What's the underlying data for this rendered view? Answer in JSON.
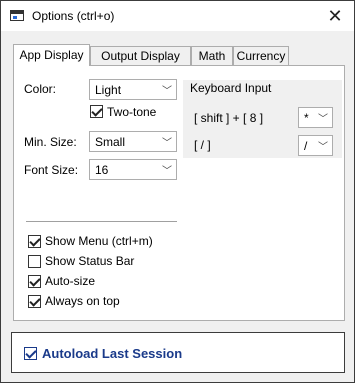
{
  "window": {
    "title": "Options (ctrl+o)",
    "close_glyph": "✕"
  },
  "tabs": [
    {
      "label": "App Display",
      "active": true
    },
    {
      "label": "Output Display",
      "active": false
    },
    {
      "label": "Math",
      "active": false
    },
    {
      "label": "Currency",
      "active": false
    }
  ],
  "app_display": {
    "color_label": "Color:",
    "color_value": "Light",
    "two_tone_label": "Two-tone",
    "two_tone_checked": true,
    "min_size_label": "Min. Size:",
    "min_size_value": "Small",
    "font_size_label": "Font Size:",
    "font_size_value": "16",
    "keyboard_input": {
      "title": "Keyboard Input",
      "shift8_label": "[ shift ] + [ 8 ]",
      "shift8_value": "*",
      "slash_label": "[ / ]",
      "slash_value": "/"
    },
    "options": [
      {
        "label": "Show Menu (ctrl+m)",
        "checked": true
      },
      {
        "label": "Show Status Bar",
        "checked": false
      },
      {
        "label": "Auto-size",
        "checked": true
      },
      {
        "label": "Always on top",
        "checked": true
      }
    ]
  },
  "autoload": {
    "label": "Autoload Last Session",
    "checked": true
  },
  "icons": {
    "dropdown": "chevron-down-icon",
    "app": "app-window-icon",
    "close": "close-icon"
  },
  "colors": {
    "autoload_text": "#1a3a8a",
    "panel_bg": "#ffffff",
    "window_bg": "#f0f0f0"
  }
}
